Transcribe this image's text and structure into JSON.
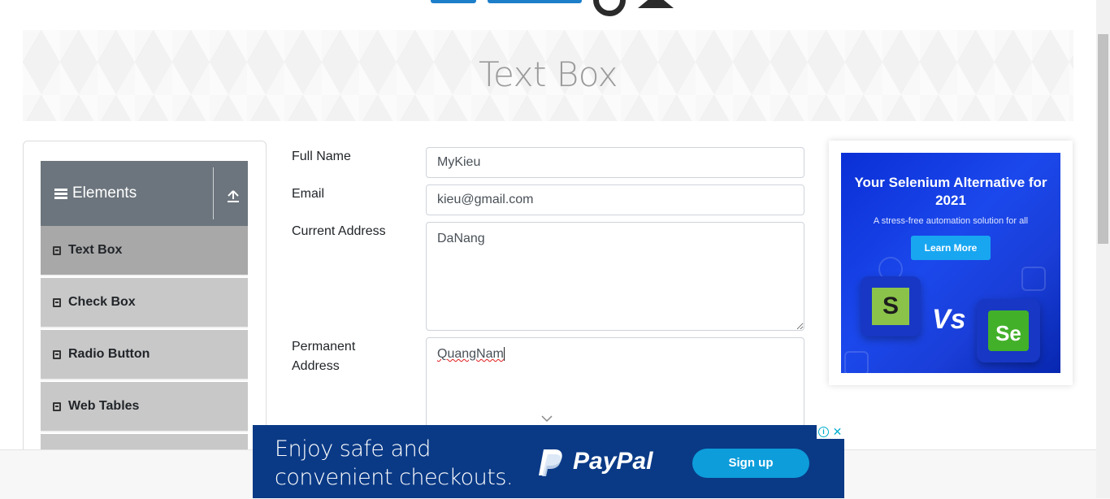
{
  "page": {
    "title": "Text Box"
  },
  "sidebar": {
    "group_title": "Elements",
    "items": [
      {
        "label": "Text Box",
        "active": true
      },
      {
        "label": "Check Box",
        "active": false
      },
      {
        "label": "Radio Button",
        "active": false
      },
      {
        "label": "Web Tables",
        "active": false
      }
    ]
  },
  "form": {
    "full_name": {
      "label": "Full Name",
      "value": "MyKieu"
    },
    "email": {
      "label": "Email",
      "value": "kieu@gmail.com"
    },
    "current_address": {
      "label": "Current Address",
      "value": "DaNang"
    },
    "permanent_address": {
      "label_line1": "Permanent",
      "label_line2": "Address",
      "value": "QuangNam"
    }
  },
  "side_ad": {
    "headline": "Your Selenium Alternative for 2021",
    "subtext": "A stress-free automation solution for all",
    "cta": "Learn More",
    "vs_text": "Vs",
    "logo_left": "S",
    "logo_right": "Se"
  },
  "bottom_ad": {
    "line1": "Enjoy safe and",
    "line2": "convenient checkouts.",
    "brand": "PayPal",
    "cta": "Sign up"
  },
  "colors": {
    "sidebar_header": "#6c757d",
    "sidebar_item": "#c8c8c8",
    "sidebar_item_active": "#a8a8a8",
    "focus_ring": "#80bdff",
    "paypal_bg": "#0a3a86",
    "paypal_button": "#0d9ddb"
  }
}
